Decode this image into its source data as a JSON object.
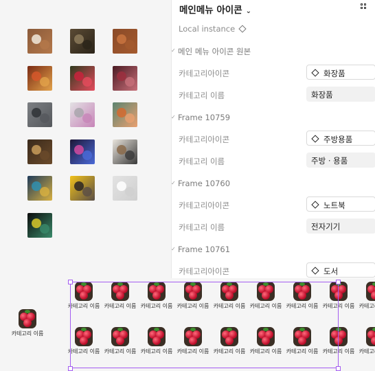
{
  "panel": {
    "title": "메인메뉴 아이콘",
    "chevron": "⌄",
    "local_instance": "Local instance",
    "source_section": "메인 메뉴 아이콘 원본",
    "icon_label": "카테고리아이콘",
    "name_label": "카테고리 이름",
    "sections": [
      {
        "title": "",
        "icon_value": "화장품",
        "name_value": "화장품"
      },
      {
        "title": "Frame 10759",
        "icon_value": "주방용품",
        "name_value": "주방 · 용품"
      },
      {
        "title": "Frame 10760",
        "icon_value": "노트북",
        "name_value": "전자기기"
      },
      {
        "title": "Frame 10761",
        "icon_value": "도서",
        "name_value": ""
      }
    ]
  },
  "canvas": {
    "thumbnails": [
      {
        "name": "eggs-bowl-thumbnail",
        "bg": "#8a5a3a",
        "c1": "#f1e9dc",
        "c2": "#b4784a"
      },
      {
        "name": "cookware-thumbnail",
        "bg": "#5a4a34",
        "c1": "#8c7a5b",
        "c2": "#2b2419"
      },
      {
        "name": "brown-eggs-thumbnail",
        "bg": "#8a4a28",
        "c1": "#c9743f",
        "c2": "#a45a2e"
      },
      {
        "name": "sausages-thumbnail",
        "bg": "#7a2a14",
        "c1": "#d6572a",
        "c2": "#e2a24a"
      },
      {
        "name": "radishes-thumbnail",
        "bg": "#2e3a1e",
        "c1": "#c8233c",
        "c2": "#e64b5d"
      },
      {
        "name": "meat-thumbnail",
        "bg": "#4a1a22",
        "c1": "#9c2f3e",
        "c2": "#c8707a"
      },
      {
        "name": "pans-thumbnail",
        "bg": "#7c7f83",
        "c1": "#2f3236",
        "c2": "#55585c"
      },
      {
        "name": "laptop-thumbnail",
        "bg": "#e3e1e4",
        "c1": "#a9a6ad",
        "c2": "#c784b8"
      },
      {
        "name": "sofa-thumbnail",
        "bg": "#5c8470",
        "c1": "#d36a2f",
        "c2": "#e9a070"
      },
      {
        "name": "wine-thumbnail",
        "bg": "#3a2a1c",
        "c1": "#c89c5a",
        "c2": "#6a4a2a"
      },
      {
        "name": "keyboard-thumbnail",
        "bg": "#1e1636",
        "c1": "#d24aa0",
        "c2": "#4a6ad8"
      },
      {
        "name": "books-thumbnail",
        "bg": "#e9e4dc",
        "c1": "#8a6a4a",
        "c2": "#3a3a3a"
      },
      {
        "name": "bookshelf-thumbnail",
        "bg": "#1d3a5a",
        "c1": "#2f8fb0",
        "c2": "#d8b040"
      },
      {
        "name": "pug-thumbnail",
        "bg": "#f2c21a",
        "c1": "#2b2623",
        "c2": "#5a4e46"
      },
      {
        "name": "chair-thumbnail",
        "bg": "#e3e3e3",
        "c1": "#ffffff",
        "c2": "#cfcfcf"
      },
      {
        "name": "fish-thumbnail",
        "bg": "#0c0c0c",
        "c1": "#d8c82a",
        "c2": "#3a8a6a"
      }
    ],
    "component_caption": "카테고리 이름",
    "instance_caption": "카테고리 이름"
  }
}
